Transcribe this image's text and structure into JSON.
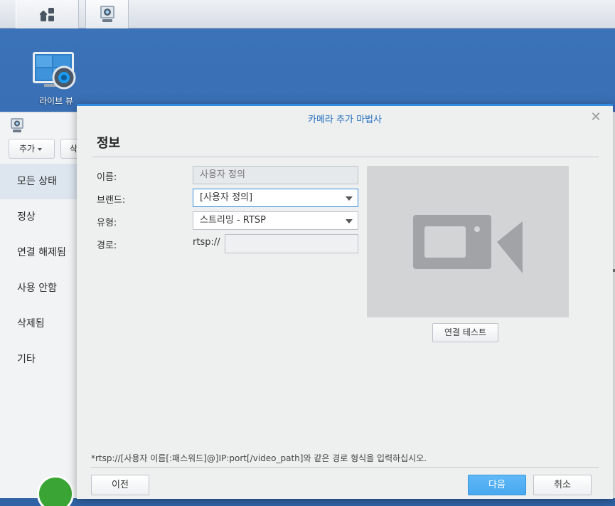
{
  "taskbar": {
    "main_menu_icon": "grid-icon",
    "app_icon": "surveillance-camera-icon"
  },
  "desktop": {
    "shortcut_label": "라이브 뷰",
    "shortcut_icon": "live-view-icon"
  },
  "background_app": {
    "toolbar": {
      "add_label": "추가",
      "second_label": "삭"
    },
    "sidebar": [
      "모든 상태",
      "정상",
      "연결 해제됨",
      "사용 안함",
      "삭제됨",
      "기타"
    ],
    "active_index": 0
  },
  "dialog": {
    "title": "카메라 추가 마법사",
    "heading": "정보",
    "fields": {
      "name_label": "이름:",
      "name_value": "사용자 정의",
      "brand_label": "브랜드:",
      "brand_value": "[사용자 정의]",
      "type_label": "유형:",
      "type_value": "스트리밍 - RTSP",
      "path_label": "경로:",
      "path_prefix": "rtsp://",
      "path_value": ""
    },
    "test_button": "연결 테스트",
    "hint": "*rtsp://[사용자 이름[:패스워드]@]IP:port[/video_path]와 같은 경로 형식을 입력하십시오.",
    "buttons": {
      "prev": "이전",
      "next": "다음",
      "cancel": "취소"
    },
    "colors": {
      "accent": "#2f8ae0",
      "next_button": "#4aa9f0",
      "title": "#2a72c1"
    }
  }
}
